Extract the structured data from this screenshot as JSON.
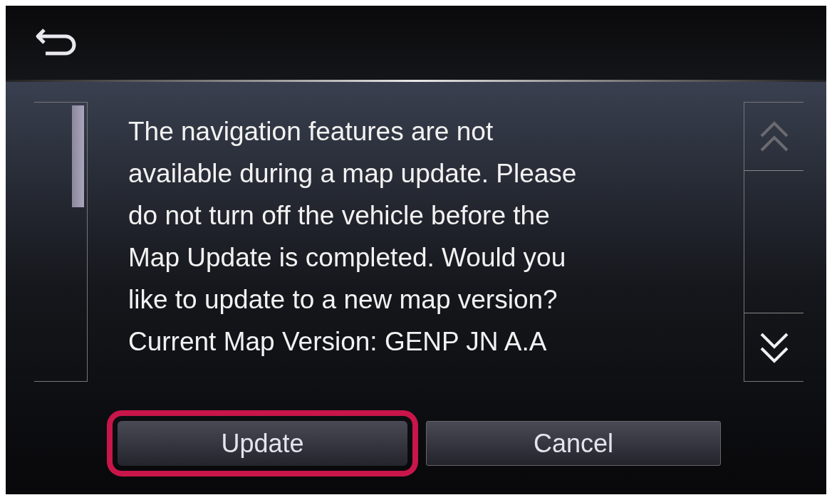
{
  "message_lines": [
    "The navigation features are not",
    "available during a map update. Please",
    "do not turn off the vehicle before the",
    "Map Update is completed. Would you",
    "like to update to a new map version?",
    "Current Map Version: GENP JN A.A"
  ],
  "scroll_up": {
    "disabled": true
  },
  "scroll_down": {
    "disabled": false
  },
  "buttons": [
    {
      "label": "Update",
      "highlighted": true
    },
    {
      "label": "Cancel",
      "highlighted": false
    }
  ]
}
